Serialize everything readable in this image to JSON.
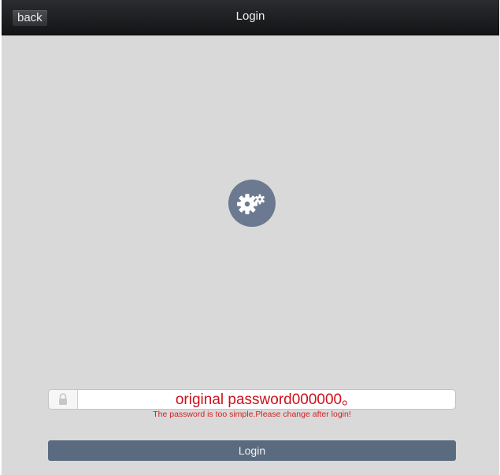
{
  "header": {
    "back_label": "back",
    "title": "Login"
  },
  "logo": {
    "icon": "gears-icon",
    "color": "#6b7a90"
  },
  "password_field": {
    "value": "original password000000。",
    "lock_icon": "lock-icon",
    "hint": "The password is too simple.Please change after login!"
  },
  "login_button": {
    "label": "Login"
  },
  "colors": {
    "background": "#d9d9d9",
    "navbar": "#1c1d1f",
    "error_text": "#d0101a",
    "button": "#5a6b80"
  }
}
